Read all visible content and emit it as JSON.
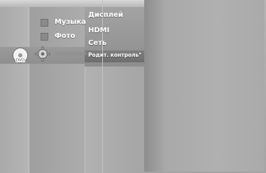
{
  "main_menu": {
    "items": [
      {
        "label": "Музыка",
        "icon": "music-icon"
      },
      {
        "label": "Фото",
        "icon": "photo-icon"
      },
      {
        "label": "Настройки",
        "icon": "gear-icon"
      }
    ],
    "left_icon": "disc-dvd-icon"
  },
  "settings_submenu": {
    "items": [
      "Дисплей",
      "HDMI",
      "Сеть",
      "Родит. контроль"
    ],
    "selected_index": 3,
    "arrow": "▸"
  }
}
